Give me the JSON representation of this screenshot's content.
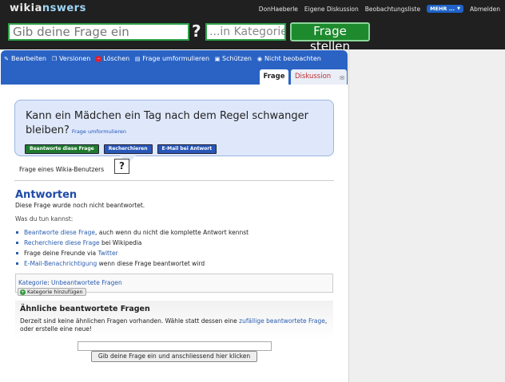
{
  "header": {
    "logo_part1": "wikia",
    "logo_part2": "nswers",
    "user_name": "DonHaeberle",
    "own_discussion": "Eigene Diskussion",
    "watchlist": "Beobachtungsliste",
    "more": "MEHR ...",
    "logout": "Abmelden",
    "ask_placeholder": "Gib deine Frage ein",
    "qmark": "?",
    "category_placeholder": "...in Kategorie",
    "ask_button": "Frage stellen",
    "colors": {
      "bar": "#202020",
      "accent_green": "#1d8a2d",
      "more_blue": "#1f63c9"
    }
  },
  "actions": {
    "edit": "Bearbeiten",
    "versions": "Versionen",
    "delete": "Löschen",
    "rephrase": "Frage umformulieren",
    "protect": "Schützen",
    "unwatch": "Nicht beobachten",
    "tab_question": "Frage",
    "tab_discussion": "Diskussion"
  },
  "question": {
    "text": "Kann ein Mädchen ein Tag nach dem Regel schwanger bleiben?",
    "rephrase_link": "Frage umformulieren",
    "btn_answer": "Beantworte diese Frage",
    "btn_research": "Recherchieren",
    "btn_email": "E-Mail bei Antwort",
    "asked_by": "Frage eines Wikia-Benutzers",
    "avatar": "?"
  },
  "answers": {
    "title": "Antworten",
    "note": "Diese Frage wurde noch nicht beantwortet.",
    "todo_title": "Was du tun kannst:",
    "item1_link": "Beantworte diese Frage",
    "item1_rest": ", auch wenn du nicht die komplette Antwort kennst",
    "item2_link": "Recherchiere diese Frage",
    "item2_rest": " bei Wikipedia",
    "item3_text": "Frage deine Freunde via ",
    "item3_link": "Twitter",
    "item4_link": "E-Mail-Benachrichtigung",
    "item4_rest": " wenn diese Frage beantwortet wird"
  },
  "category": {
    "label": "Kategorie",
    "separator": ": ",
    "value": "Unbeantwortete Fragen",
    "add_button": "Kategorie hinzufügen"
  },
  "related": {
    "title": "Ähnliche beantwortete Fragen",
    "text_before": "Derzeit sind keine ähnlichen Fragen vorhanden. Wähle statt dessen eine ",
    "random_link": "zufällige beantwortete Frage",
    "text_after": ", oder erstelle eine neue!"
  },
  "bottom": {
    "button": "Gib deine Frage ein und anschliessend hier klicken"
  }
}
